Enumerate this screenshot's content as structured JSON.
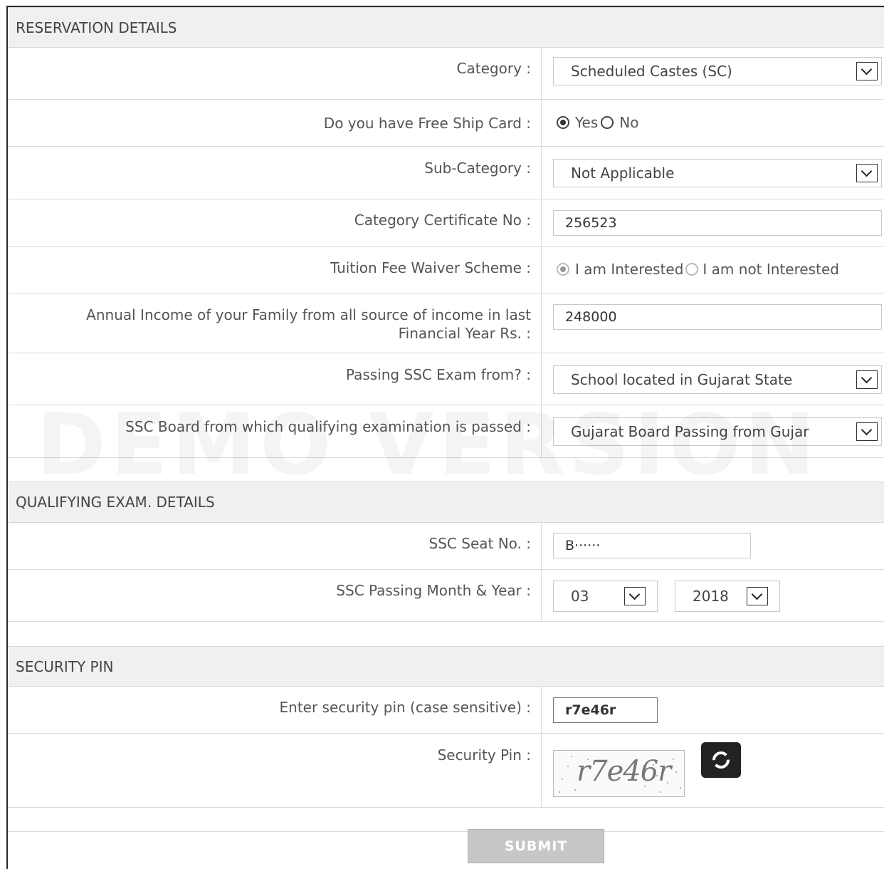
{
  "reservation": {
    "heading": "RESERVATION DETAILS",
    "category": {
      "label": "Category :",
      "value": "Scheduled Castes (SC)"
    },
    "free_ship": {
      "label": "Do you have Free Ship Card :",
      "options": [
        "Yes",
        "No"
      ],
      "selected": "Yes"
    },
    "sub_category": {
      "label": "Sub-Category :",
      "value": "Not Applicable"
    },
    "certificate": {
      "label": "Category Certificate No :",
      "value": "256523"
    },
    "tfws": {
      "label": "Tuition Fee Waiver Scheme :",
      "options": [
        "I am Interested",
        "I am not Interested"
      ],
      "selected": "I am Interested"
    },
    "income": {
      "label_line1": "Annual Income of your Family from all source of income in last",
      "label_line2": "Financial Year Rs. :",
      "value": "248000"
    },
    "ssc_from": {
      "label": "Passing SSC Exam from? :",
      "value": "School located in Gujarat State"
    },
    "ssc_board": {
      "label": "SSC Board from which qualifying examination is passed :",
      "value": "Gujarat Board Passing from Gujar"
    }
  },
  "watermark": "DEMO VERSION",
  "qualifying": {
    "heading": "QUALIFYING EXAM. DETAILS",
    "seat": {
      "label": "SSC Seat No. :",
      "value": "B······"
    },
    "passing": {
      "label": "SSC Passing Month & Year :",
      "month": "03",
      "year": "2018"
    }
  },
  "security": {
    "heading": "SECURITY PIN",
    "enter": {
      "label": "Enter security pin (case sensitive) :",
      "value": "r7e46r"
    },
    "pin": {
      "label": "Security Pin :",
      "captcha": "r7e46r",
      "refresh_icon": "refresh-icon"
    }
  },
  "submit_label": "SUBMIT"
}
